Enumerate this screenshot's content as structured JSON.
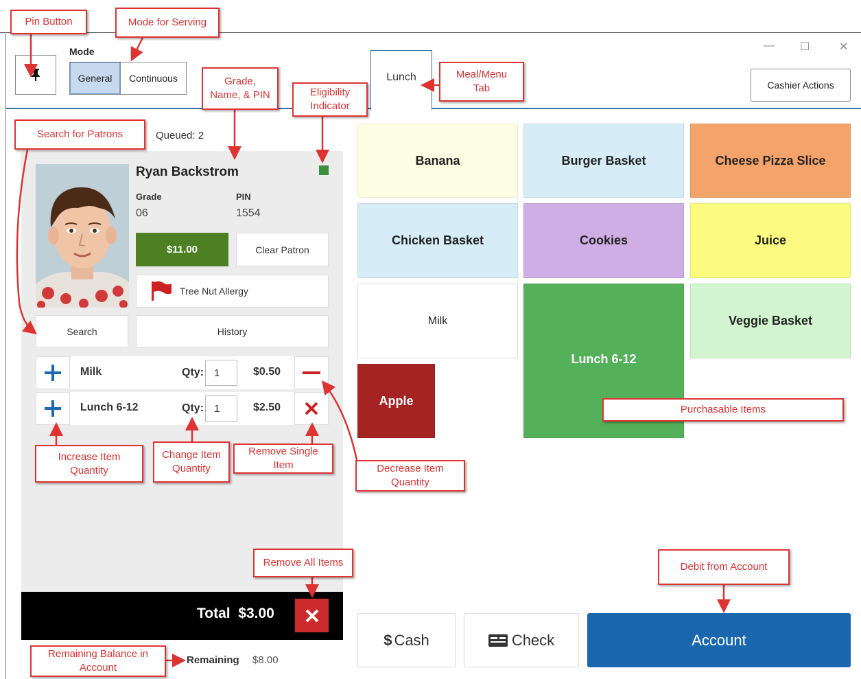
{
  "header": {
    "mode_label": "Mode",
    "mode_options": [
      "General",
      "Continuous"
    ],
    "mode_selected": "General",
    "tab_label": "Lunch",
    "cashier_actions": "Cashier Actions"
  },
  "queue": {
    "label": "Queued: 2"
  },
  "patron": {
    "name": "Ryan Backstrom",
    "grade_label": "Grade",
    "grade": "06",
    "pin_label": "PIN",
    "pin": "1554",
    "balance": "$11.00",
    "clear_label": "Clear Patron",
    "allergy": "Tree Nut Allergy",
    "search_label": "Search",
    "history_label": "History",
    "eligibility_color": "#3e8f3e"
  },
  "cart": {
    "qty_label": "Qty:",
    "items": [
      {
        "name": "Milk",
        "qty": "1",
        "price": "$0.50"
      },
      {
        "name": "Lunch 6-12",
        "qty": "1",
        "price": "$2.50"
      }
    ],
    "total_label": "Total",
    "total": "$3.00",
    "remaining_label": "Remaining",
    "remaining": "$8.00"
  },
  "menu": {
    "items": [
      {
        "label": "Banana",
        "color": "#fdfde3"
      },
      {
        "label": "Burger Basket",
        "color": "#d6ecf7"
      },
      {
        "label": "Cheese Pizza Slice",
        "color": "#f4a36b"
      },
      {
        "label": "Chicken Basket",
        "color": "#d6ecf7"
      },
      {
        "label": "Cookies",
        "color": "#cfaee6"
      },
      {
        "label": "Juice",
        "color": "#fbfb80"
      },
      {
        "label": "Milk",
        "color": "#ffffff"
      },
      {
        "label": "Lunch 6-12",
        "color": "#55b05a"
      },
      {
        "label": "Veggie Basket",
        "color": "#d2f5d0"
      },
      {
        "label": "Apple",
        "color": "#a52323"
      }
    ]
  },
  "payment": {
    "cash": "Cash",
    "cash_symbol": "$",
    "check": "Check",
    "account": "Account",
    "account_color": "#1a67b0"
  },
  "callouts": {
    "pin_button": "Pin Button",
    "mode_for_serving": "Mode for Serving",
    "grade_name_pin": "Grade,\nName, & PIN",
    "eligibility": "Eligibility\nIndicator",
    "meal_tab": "Meal/Menu\nTab",
    "search_patrons": "Search for Patrons",
    "increase_qty": "Increase Item\nQuantity",
    "change_qty": "Change Item\nQuantity",
    "remove_single": "Remove Single\nItem",
    "decrease_qty": "Decrease Item\nQuantity",
    "purchasable": "Purchasable Items",
    "remove_all": "Remove All Items",
    "debit_account": "Debit from Account",
    "remaining_balance": "Remaining Balance in\nAccount"
  },
  "icons": {
    "pin": "pushpin-icon",
    "flag": "flag-icon",
    "plus": "plus-icon",
    "minus": "minus-icon",
    "close": "x-icon",
    "check": "check-card-icon"
  }
}
